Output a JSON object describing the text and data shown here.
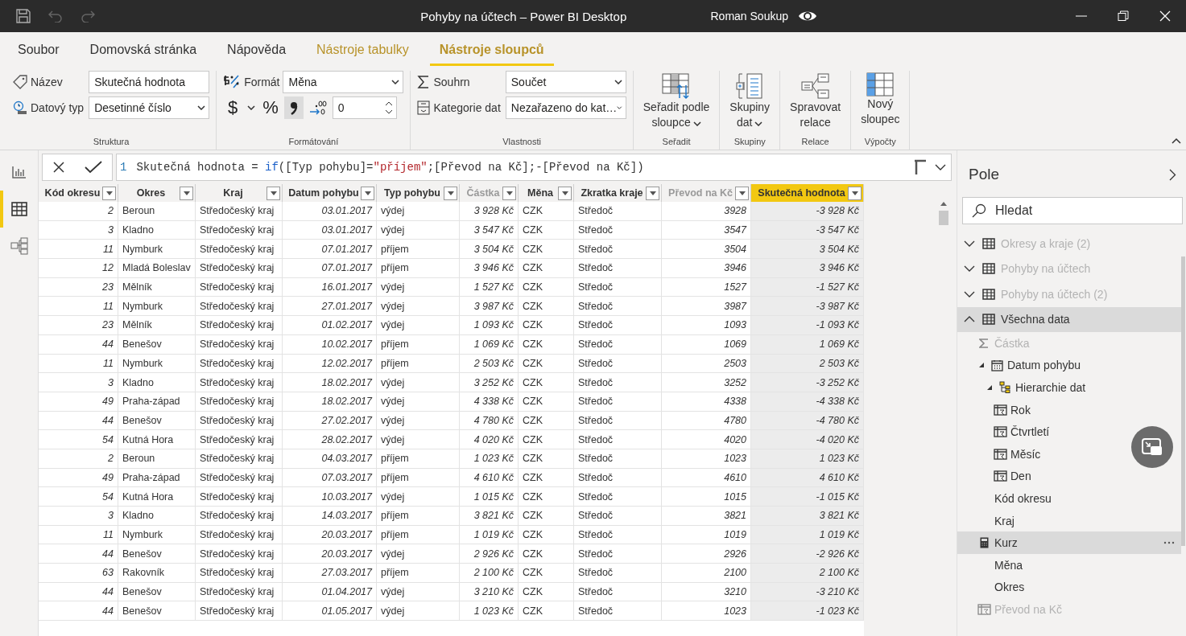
{
  "window": {
    "title": "Pohyby na účtech – Power BI Desktop",
    "user": "Roman Soukup"
  },
  "ribbon": {
    "tabs": [
      {
        "label": "Soubor",
        "selected": false,
        "kind": "normal"
      },
      {
        "label": "Domovská stránka",
        "selected": false,
        "kind": "normal"
      },
      {
        "label": "Nápověda",
        "selected": false,
        "kind": "normal"
      },
      {
        "label": "Nástroje tabulky",
        "selected": false,
        "kind": "contextual"
      },
      {
        "label": "Nástroje sloupců",
        "selected": true,
        "kind": "contextual"
      }
    ],
    "structure": {
      "label": "Struktura",
      "name_label": "Název",
      "name_value": "Skutečná hodnota",
      "type_label": "Datový typ",
      "type_value": "Desetinné číslo"
    },
    "formatting": {
      "label": "Formátování",
      "format_label": "Formát",
      "format_value": "Měna",
      "currency_symbol": "$",
      "percent_symbol": "%",
      "comma_selected": true,
      "decimals_value": "0"
    },
    "properties": {
      "label": "Vlastnosti",
      "summary_label": "Souhrn",
      "summary_value": "Součet",
      "category_label": "Kategorie dat",
      "category_value": "Nezařazeno do kat…"
    },
    "big_groups": [
      {
        "label": "Seřadit",
        "kind": "sort",
        "lines": [
          "Seřadit podle",
          "sloupce"
        ],
        "dropdown": true
      },
      {
        "label": "Skupiny",
        "kind": "groups",
        "lines": [
          "Skupiny",
          "dat"
        ],
        "dropdown": true
      },
      {
        "label": "Relace",
        "kind": "relations",
        "lines": [
          "Spravovat",
          "relace"
        ],
        "dropdown": false
      },
      {
        "label": "Výpočty",
        "kind": "newcolumn",
        "lines": [
          "Nový",
          "sloupec"
        ],
        "dropdown": false
      }
    ]
  },
  "views": [
    {
      "kind": "report",
      "selected": false
    },
    {
      "kind": "data",
      "selected": true
    },
    {
      "kind": "model",
      "selected": false
    }
  ],
  "formula": {
    "line": "1",
    "segments": [
      {
        "kind": "plain",
        "text": "Skutečná hodnota = "
      },
      {
        "kind": "keyword",
        "text": "if"
      },
      {
        "kind": "plain",
        "text": "([Typ pohybu]="
      },
      {
        "kind": "string",
        "text": "\"příjem\""
      },
      {
        "kind": "plain",
        "text": ";[Převod na Kč];-[Převod na Kč])"
      }
    ]
  },
  "table": {
    "columns": [
      {
        "label": "Kód okresu",
        "italic": true,
        "dim": false,
        "selected": false
      },
      {
        "label": "Okres",
        "italic": false,
        "dim": false,
        "selected": false
      },
      {
        "label": "Kraj",
        "italic": false,
        "dim": false,
        "selected": false
      },
      {
        "label": "Datum pohybu",
        "italic": true,
        "dim": false,
        "selected": false
      },
      {
        "label": "Typ pohybu",
        "italic": false,
        "dim": false,
        "selected": false
      },
      {
        "label": "Částka",
        "italic": true,
        "dim": true,
        "selected": false
      },
      {
        "label": "Měna",
        "italic": false,
        "dim": false,
        "selected": false
      },
      {
        "label": "Zkratka kraje",
        "italic": false,
        "dim": false,
        "selected": false
      },
      {
        "label": "Převod na Kč",
        "italic": true,
        "dim": true,
        "selected": false
      },
      {
        "label": "Skutečná hodnota",
        "italic": true,
        "dim": false,
        "selected": true
      }
    ],
    "rows": [
      [
        "2",
        "Beroun",
        "Středočeský kraj",
        "03.01.2017",
        "výdej",
        "3 928 Kč",
        "CZK",
        "Středoč",
        "3928",
        "-3 928 Kč"
      ],
      [
        "3",
        "Kladno",
        "Středočeský kraj",
        "03.01.2017",
        "výdej",
        "3 547 Kč",
        "CZK",
        "Středoč",
        "3547",
        "-3 547 Kč"
      ],
      [
        "11",
        "Nymburk",
        "Středočeský kraj",
        "07.01.2017",
        "příjem",
        "3 504 Kč",
        "CZK",
        "Středoč",
        "3504",
        "3 504 Kč"
      ],
      [
        "12",
        "Mladá Boleslav",
        "Středočeský kraj",
        "07.01.2017",
        "příjem",
        "3 946 Kč",
        "CZK",
        "Středoč",
        "3946",
        "3 946 Kč"
      ],
      [
        "23",
        "Mělník",
        "Středočeský kraj",
        "16.01.2017",
        "výdej",
        "1 527 Kč",
        "CZK",
        "Středoč",
        "1527",
        "-1 527 Kč"
      ],
      [
        "11",
        "Nymburk",
        "Středočeský kraj",
        "27.01.2017",
        "výdej",
        "3 987 Kč",
        "CZK",
        "Středoč",
        "3987",
        "-3 987 Kč"
      ],
      [
        "23",
        "Mělník",
        "Středočeský kraj",
        "01.02.2017",
        "výdej",
        "1 093 Kč",
        "CZK",
        "Středoč",
        "1093",
        "-1 093 Kč"
      ],
      [
        "44",
        "Benešov",
        "Středočeský kraj",
        "10.02.2017",
        "příjem",
        "1 069 Kč",
        "CZK",
        "Středoč",
        "1069",
        "1 069 Kč"
      ],
      [
        "11",
        "Nymburk",
        "Středočeský kraj",
        "12.02.2017",
        "příjem",
        "2 503 Kč",
        "CZK",
        "Středoč",
        "2503",
        "2 503 Kč"
      ],
      [
        "3",
        "Kladno",
        "Středočeský kraj",
        "18.02.2017",
        "výdej",
        "3 252 Kč",
        "CZK",
        "Středoč",
        "3252",
        "-3 252 Kč"
      ],
      [
        "49",
        "Praha-západ",
        "Středočeský kraj",
        "18.02.2017",
        "výdej",
        "4 338 Kč",
        "CZK",
        "Středoč",
        "4338",
        "-4 338 Kč"
      ],
      [
        "44",
        "Benešov",
        "Středočeský kraj",
        "27.02.2017",
        "výdej",
        "4 780 Kč",
        "CZK",
        "Středoč",
        "4780",
        "-4 780 Kč"
      ],
      [
        "54",
        "Kutná Hora",
        "Středočeský kraj",
        "28.02.2017",
        "výdej",
        "4 020 Kč",
        "CZK",
        "Středoč",
        "4020",
        "-4 020 Kč"
      ],
      [
        "2",
        "Beroun",
        "Středočeský kraj",
        "04.03.2017",
        "příjem",
        "1 023 Kč",
        "CZK",
        "Středoč",
        "1023",
        "1 023 Kč"
      ],
      [
        "49",
        "Praha-západ",
        "Středočeský kraj",
        "07.03.2017",
        "příjem",
        "4 610 Kč",
        "CZK",
        "Středoč",
        "4610",
        "4 610 Kč"
      ],
      [
        "54",
        "Kutná Hora",
        "Středočeský kraj",
        "10.03.2017",
        "výdej",
        "1 015 Kč",
        "CZK",
        "Středoč",
        "1015",
        "-1 015 Kč"
      ],
      [
        "3",
        "Kladno",
        "Středočeský kraj",
        "14.03.2017",
        "příjem",
        "3 821 Kč",
        "CZK",
        "Středoč",
        "3821",
        "3 821 Kč"
      ],
      [
        "11",
        "Nymburk",
        "Středočeský kraj",
        "20.03.2017",
        "příjem",
        "1 019 Kč",
        "CZK",
        "Středoč",
        "1019",
        "1 019 Kč"
      ],
      [
        "44",
        "Benešov",
        "Středočeský kraj",
        "20.03.2017",
        "výdej",
        "2 926 Kč",
        "CZK",
        "Středoč",
        "2926",
        "-2 926 Kč"
      ],
      [
        "63",
        "Rakovník",
        "Středočeský kraj",
        "27.03.2017",
        "příjem",
        "2 100 Kč",
        "CZK",
        "Středoč",
        "2100",
        "2 100 Kč"
      ],
      [
        "44",
        "Benešov",
        "Středočeský kraj",
        "01.04.2017",
        "výdej",
        "3 210 Kč",
        "CZK",
        "Středoč",
        "3210",
        "-3 210 Kč"
      ],
      [
        "44",
        "Benešov",
        "Středočeský kraj",
        "01.05.2017",
        "výdej",
        "1 023 Kč",
        "CZK",
        "Středoč",
        "1023",
        "-1 023 Kč"
      ]
    ]
  },
  "fields": {
    "title": "Pole",
    "search_placeholder": "Hledat",
    "tables": [
      {
        "label": "Okresy a kraje (2)",
        "dim": true,
        "expanded": false
      },
      {
        "label": "Pohyby na účtech",
        "dim": true,
        "expanded": false
      },
      {
        "label": "Pohyby na účtech (2)",
        "dim": true,
        "expanded": false
      },
      {
        "label": "Všechna data",
        "dim": false,
        "expanded": true,
        "children": [
          {
            "label": "Částka",
            "kind": "measure",
            "dim": true,
            "hovered": false
          },
          {
            "label": "Datum pohybu",
            "kind": "date",
            "dim": false,
            "hovered": false,
            "expanded": true,
            "children": [
              {
                "label": "Hierarchie dat",
                "kind": "hierarchy",
                "dim": false,
                "hovered": false,
                "expanded": true,
                "children": [
                  {
                    "label": "Rok",
                    "kind": "level",
                    "dim": false,
                    "hovered": false
                  },
                  {
                    "label": "Čtvrtletí",
                    "kind": "level",
                    "dim": false,
                    "hovered": false
                  },
                  {
                    "label": "Měsíc",
                    "kind": "level",
                    "dim": false,
                    "hovered": false
                  },
                  {
                    "label": "Den",
                    "kind": "level",
                    "dim": false,
                    "hovered": false
                  }
                ]
              }
            ]
          },
          {
            "label": "Kód okresu",
            "kind": "plain",
            "dim": false,
            "hovered": false
          },
          {
            "label": "Kraj",
            "kind": "plain",
            "dim": false,
            "hovered": false
          },
          {
            "label": "Kurz",
            "kind": "calculator",
            "dim": false,
            "hovered": true
          },
          {
            "label": "Měna",
            "kind": "plain",
            "dim": false,
            "hovered": false
          },
          {
            "label": "Okres",
            "kind": "plain",
            "dim": false,
            "hovered": false
          },
          {
            "label": "Převod na Kč",
            "kind": "level",
            "dim": true,
            "hovered": false
          }
        ]
      }
    ]
  }
}
